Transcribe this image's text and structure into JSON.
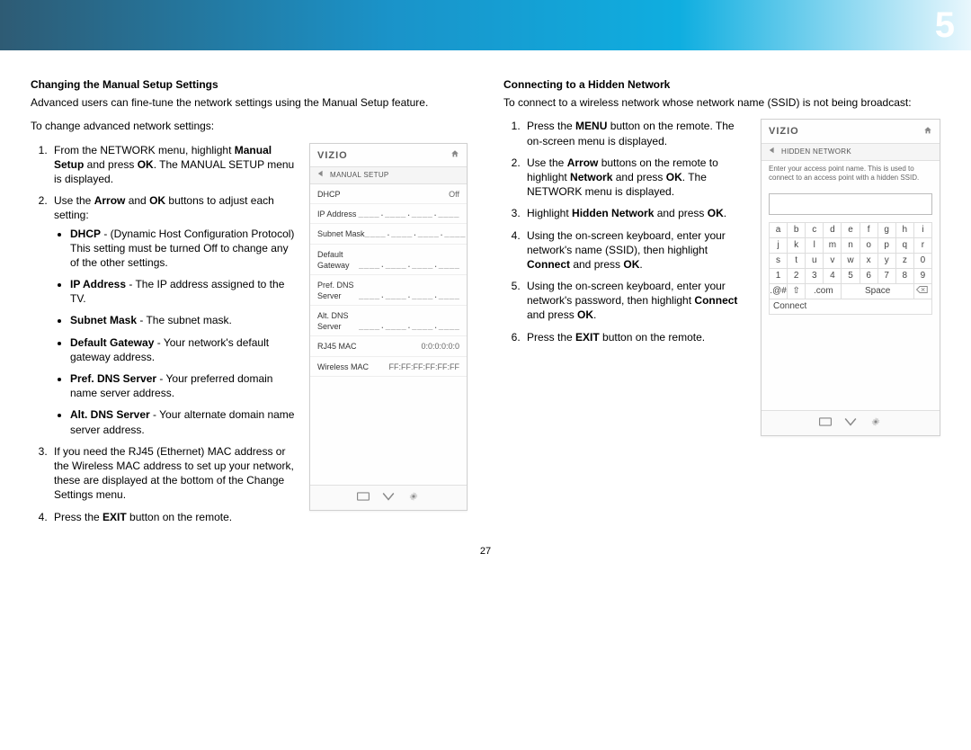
{
  "chapter_number": "5",
  "page_number": "27",
  "left": {
    "heading": "Changing the Manual Setup Settings",
    "intro": "Advanced users can fine-tune the network settings using the Manual Setup feature.",
    "lead": "To change advanced network settings:",
    "step1_a": "From the NETWORK menu, highlight ",
    "step1_b": "Manual Setup",
    "step1_c": " and press ",
    "step1_d": "OK",
    "step1_e": ". The MANUAL SETUP menu is displayed.",
    "step2_a": "Use the ",
    "step2_b": "Arrow",
    "step2_c": " and ",
    "step2_d": "OK",
    "step2_e": " buttons to adjust each setting:",
    "bul_dhcp_b": "DHCP",
    "bul_dhcp_t": " - (Dynamic Host Configuration Protocol) This setting must be turned Off to change any of the other settings.",
    "bul_ip_b": "IP Address",
    "bul_ip_t": " - The IP address assigned to the TV.",
    "bul_sm_b": "Subnet Mask",
    "bul_sm_t": " - The subnet mask.",
    "bul_dg_b": "Default Gateway",
    "bul_dg_t": " - Your network's default gateway address.",
    "bul_pd_b": "Pref. DNS Server",
    "bul_pd_t": " - Your preferred domain name server address.",
    "bul_ad_b": "Alt. DNS Server",
    "bul_ad_t": " - Your alternate domain name server address.",
    "step3": "If you need the RJ45 (Ethernet) MAC address or the Wireless MAC address to set up your network, these are displayed at the bottom of the Change Settings menu.",
    "step4_a": "Press the ",
    "step4_b": "EXIT",
    "step4_c": " button on the remote.",
    "panel": {
      "brand": "VIZIO",
      "title": "MANUAL SETUP",
      "rows": [
        {
          "k": "DHCP",
          "v": "Off"
        },
        {
          "k": "IP Address",
          "v": "____.____.____.____"
        },
        {
          "k": "Subnet Mask",
          "v": "____.____.____.____"
        },
        {
          "k": "Default Gateway",
          "v": "____.____.____.____"
        },
        {
          "k": "Pref. DNS Server",
          "v": "____.____.____.____"
        },
        {
          "k": "Alt. DNS Server",
          "v": "____.____.____.____"
        },
        {
          "k": "RJ45 MAC",
          "v": "0:0:0:0:0:0"
        },
        {
          "k": "Wireless MAC",
          "v": "FF:FF:FF:FF:FF:FF"
        }
      ]
    }
  },
  "right": {
    "heading": "Connecting to a Hidden Network",
    "intro": "To connect to a wireless network whose network name (SSID) is not being broadcast:",
    "s1_a": "Press the ",
    "s1_b": "MENU",
    "s1_c": " button on the remote. The on-screen menu is displayed.",
    "s2_a": "Use the ",
    "s2_b": "Arrow",
    "s2_c": " buttons on the remote to highlight ",
    "s2_d": "Network",
    "s2_e": " and press ",
    "s2_f": "OK",
    "s2_g": ". The NETWORK menu is displayed.",
    "s3_a": "Highlight ",
    "s3_b": "Hidden Network",
    "s3_c": " and press ",
    "s3_d": "OK",
    "s3_e": ".",
    "s4_a": "Using the on-screen keyboard, enter your network's name (SSID), then highlight ",
    "s4_b": "Connect",
    "s4_c": " and press ",
    "s4_d": "OK",
    "s4_e": ".",
    "s5_a": "Using the on-screen keyboard, enter your network's password, then highlight ",
    "s5_b": "Connect",
    "s5_c": " and press ",
    "s5_d": "OK",
    "s5_e": ".",
    "s6_a": "Press the ",
    "s6_b": "EXIT",
    "s6_c": " button on the remote.",
    "panel": {
      "brand": "VIZIO",
      "title": "HIDDEN NETWORK",
      "hint": "Enter your access point name. This is used to connect to an access point with a hidden SSID.",
      "keys_r1": [
        "a",
        "b",
        "c",
        "d",
        "e",
        "f",
        "g",
        "h",
        "i"
      ],
      "keys_r2": [
        "j",
        "k",
        "l",
        "m",
        "n",
        "o",
        "p",
        "q",
        "r"
      ],
      "keys_r3": [
        "s",
        "t",
        "u",
        "v",
        "w",
        "x",
        "y",
        "z",
        "0"
      ],
      "keys_r4": [
        "1",
        "2",
        "3",
        "4",
        "5",
        "6",
        "7",
        "8",
        "9"
      ],
      "sym": ".@#",
      "com_key": ".com",
      "space_key": "Space",
      "connect": "Connect"
    }
  }
}
